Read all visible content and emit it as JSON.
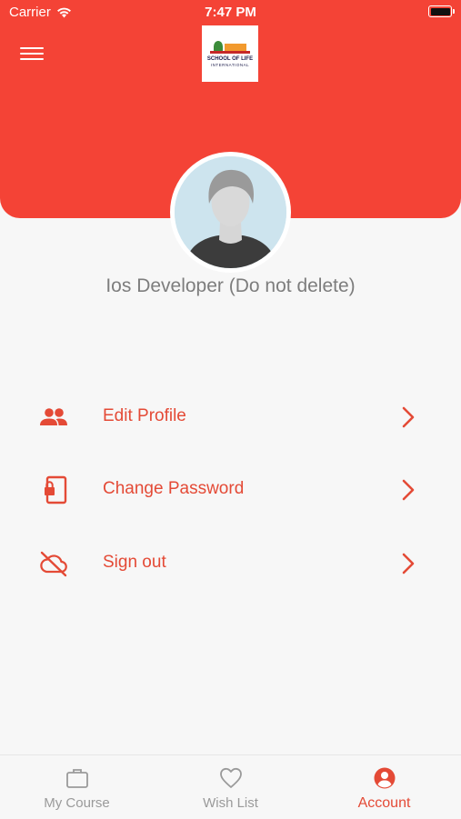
{
  "status_bar": {
    "carrier": "Carrier",
    "time": "7:47 PM"
  },
  "header": {
    "logo_line1": "SCHOOL OF LIFE",
    "logo_line2": "INTERNATIONAL"
  },
  "profile": {
    "name": "Ios Developer (Do not delete)"
  },
  "menu": [
    {
      "label": "Edit Profile",
      "icon": "people-icon"
    },
    {
      "label": "Change Password",
      "icon": "phone-lock-icon"
    },
    {
      "label": "Sign out",
      "icon": "cloud-off-icon"
    }
  ],
  "tabs": [
    {
      "label": "My Course",
      "icon": "briefcase-icon",
      "active": false
    },
    {
      "label": "Wish List",
      "icon": "heart-icon",
      "active": false
    },
    {
      "label": "Account",
      "icon": "account-circle-icon",
      "active": true
    }
  ],
  "colors": {
    "primary": "#f44336",
    "accent_text": "#e44a36",
    "inactive": "#9a9a9a",
    "background": "#f7f7f7"
  }
}
